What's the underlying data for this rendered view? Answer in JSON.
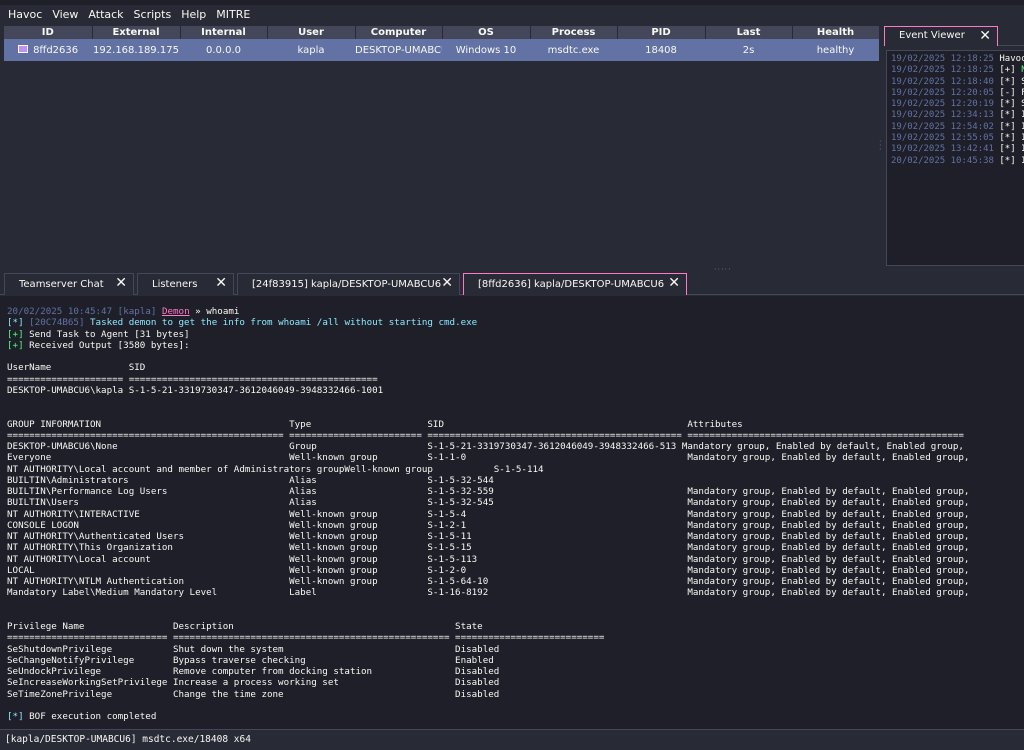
{
  "menu": [
    "Havoc",
    "View",
    "Attack",
    "Scripts",
    "Help",
    "MITRE"
  ],
  "sessions": {
    "headers": [
      "ID",
      "External",
      "Internal",
      "User",
      "Computer",
      "OS",
      "Process",
      "PID",
      "Last",
      "Health"
    ],
    "row": [
      "8ffd2636",
      "192.168.189.175",
      "0.0.0.0",
      "kapla",
      "DESKTOP-UMABCU6",
      "Windows 10",
      "msdtc.exe",
      "18408",
      "2s",
      "healthy"
    ]
  },
  "event_viewer": {
    "tab_label": "Event Viewer",
    "lines": [
      {
        "ts": "19/02/2025 12:18:25",
        "tag": "",
        "msg": "Havoc"
      },
      {
        "ts": "19/02/2025 12:18:25",
        "tag": "[+]",
        "msg": "N"
      },
      {
        "ts": "19/02/2025 12:18:40",
        "tag": "[*]",
        "msg": "S"
      },
      {
        "ts": "19/02/2025 12:20:05",
        "tag": "[-]",
        "msg": "F"
      },
      {
        "ts": "19/02/2025 12:20:19",
        "tag": "[*]",
        "msg": "S"
      },
      {
        "ts": "19/02/2025 12:34:13",
        "tag": "[*]",
        "msg": "I"
      },
      {
        "ts": "19/02/2025 12:54:02",
        "tag": "[*]",
        "msg": "I"
      },
      {
        "ts": "19/02/2025 12:55:05",
        "tag": "[*]",
        "msg": "I"
      },
      {
        "ts": "19/02/2025 13:42:41",
        "tag": "[*]",
        "msg": "I"
      },
      {
        "ts": "20/02/2025 10:45:38",
        "tag": "[*]",
        "msg": "I"
      }
    ]
  },
  "tabs": [
    {
      "label": "Teamserver Chat"
    },
    {
      "label": "Listeners"
    },
    {
      "label": "[24f83915] kapla/DESKTOP-UMABCU6"
    },
    {
      "label": "[8ffd2636] kapla/DESKTOP-UMABCU6"
    }
  ],
  "console": {
    "cmd_ts": "20/02/2025 10:45:47",
    "cmd_user": "[kapla]",
    "cmd_demon": "Demon",
    "cmd_sep": " » ",
    "cmd_text": "whoami",
    "task_tag": "[*]",
    "task_id": "[20C74B65]",
    "task_msg": " Tasked demon to get the info from whoami /all without starting cmd.exe",
    "send_tag": "[+]",
    "send_msg": " Send Task to Agent [31 bytes]",
    "recv_tag": "[+]",
    "recv_msg": " Received Output [3580 bytes]:",
    "output_1": [
      "UserName              SID",
      "===================== =============================================",
      "DESKTOP-UMABCU6\\kapla S-1-5-21-3319730347-3612046049-3948332466-1001"
    ],
    "output_2": [
      "GROUP INFORMATION                                  Type                     SID                                            Attributes",
      "================================================== ======================== ============================================== ==================================================",
      "DESKTOP-UMABCU6\\None                               Group                    S-1-5-21-3319730347-3612046049-3948332466-513 Mandatory group, Enabled by default, Enabled group,",
      "Everyone                                           Well-known group         S-1-1-0                                        Mandatory group, Enabled by default, Enabled group,",
      "NT AUTHORITY\\Local account and member of Administrators groupWell-known group           S-1-5-114",
      "BUILTIN\\Administrators                             Alias                    S-1-5-32-544",
      "BUILTIN\\Performance Log Users                      Alias                    S-1-5-32-559                                   Mandatory group, Enabled by default, Enabled group,",
      "BUILTIN\\Users                                      Alias                    S-1-5-32-545                                   Mandatory group, Enabled by default, Enabled group,",
      "NT AUTHORITY\\INTERACTIVE                           Well-known group         S-1-5-4                                        Mandatory group, Enabled by default, Enabled group,",
      "CONSOLE LOGON                                      Well-known group         S-1-2-1                                        Mandatory group, Enabled by default, Enabled group,",
      "NT AUTHORITY\\Authenticated Users                   Well-known group         S-1-5-11                                       Mandatory group, Enabled by default, Enabled group,",
      "NT AUTHORITY\\This Organization                     Well-known group         S-1-5-15                                       Mandatory group, Enabled by default, Enabled group,",
      "NT AUTHORITY\\Local account                         Well-known group         S-1-5-113                                      Mandatory group, Enabled by default, Enabled group,",
      "LOCAL                                              Well-known group         S-1-2-0                                        Mandatory group, Enabled by default, Enabled group,",
      "NT AUTHORITY\\NTLM Authentication                   Well-known group         S-1-5-64-10                                    Mandatory group, Enabled by default, Enabled group,",
      "Mandatory Label\\Medium Mandatory Level             Label                    S-1-16-8192                                    Mandatory group, Enabled by default, Enabled group,"
    ],
    "output_3": [
      "Privilege Name                Description                                        State",
      "============================= ================================================== ===========================",
      "SeShutdownPrivilege           Shut down the system                               Disabled",
      "SeChangeNotifyPrivilege       Bypass traverse checking                           Enabled",
      "SeUndockPrivilege             Remove computer from docking station               Disabled",
      "SeIncreaseWorkingSetPrivilege Increase a process working set                     Disabled",
      "SeTimeZonePrivilege           Change the time zone                               Disabled"
    ],
    "bof_tag": "[*]",
    "bof_msg": " BOF execution completed"
  },
  "statusbar": "[kapla/DESKTOP-UMABCU6] msdtc.exe/18408 x64",
  "colors": {
    "background": "#282a36",
    "console_bg": "#1e1f29",
    "row_highlight": "#6272a4",
    "accent_pink": "#ff79c6",
    "info_cyan": "#8be9fd",
    "ok_green": "#50fa7b"
  },
  "icons": {
    "session_row": "monitor-icon",
    "tab_close": "close-icon"
  }
}
